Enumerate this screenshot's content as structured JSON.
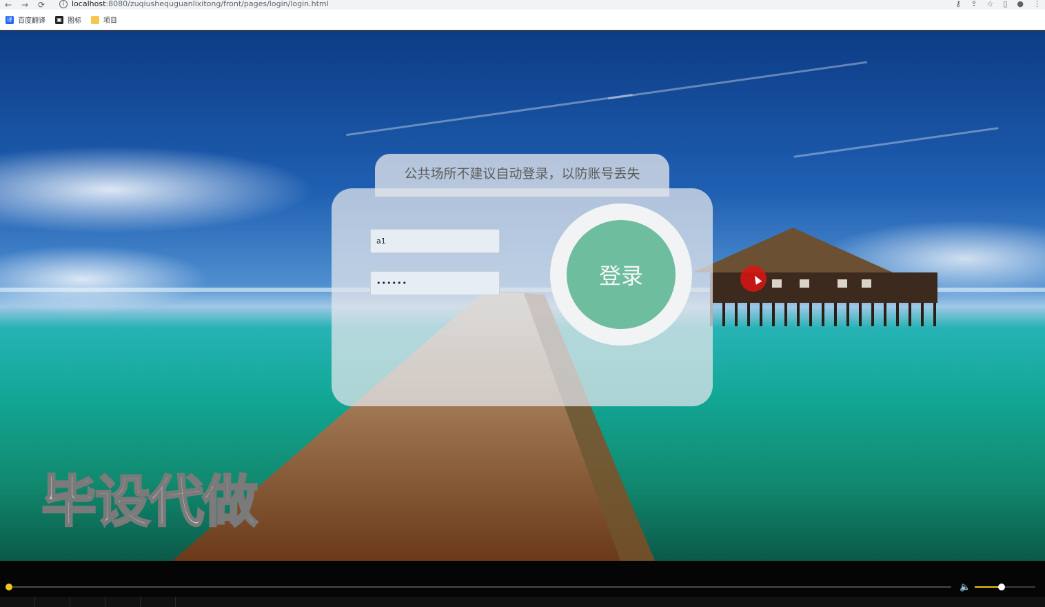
{
  "browser": {
    "url_host": "localhost",
    "url_path": ":8080/zuqiushequguanlixitong/front/pages/login/login.html",
    "nav": {
      "back": "←",
      "forward": "→",
      "reload": "⟳"
    },
    "right_icons": [
      "⚷",
      "⇪",
      "☆",
      "▯",
      "●",
      "⋮"
    ]
  },
  "bookmarks": [
    {
      "label": "百度翻译",
      "color": "#2468f2",
      "glyph": "译"
    },
    {
      "label": "图标",
      "color": "#222222",
      "glyph": "▣"
    },
    {
      "label": "项目",
      "color": "#f5c84c",
      "glyph": ""
    }
  ],
  "login": {
    "notice": "公共场所不建议自动登录，以防账号丢失",
    "username_value": "a1",
    "password_value": "••••••",
    "login_button": "登录"
  },
  "watermark": "毕设代做",
  "player": {
    "progress": 0.0,
    "volume": 0.4,
    "volume_icon": "🔈",
    "accent": "#f3c41c"
  },
  "colors": {
    "login_button": "#6fbd9f",
    "card": "rgba(225,228,233,0.75)"
  }
}
